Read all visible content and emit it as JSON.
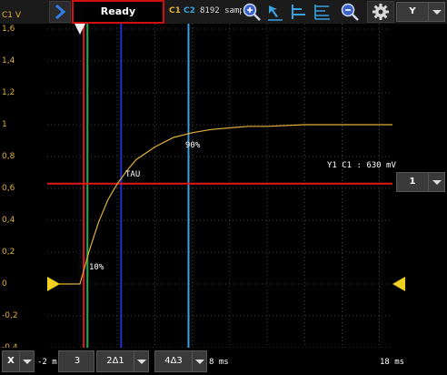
{
  "toolbar": {
    "status": "Ready",
    "ch1": "C1",
    "ch2": "C2",
    "samples": "8192 samp",
    "y_selector": "Y",
    "icons": [
      "play-icon",
      "zoom-in-icon",
      "cursor-arrow-icon",
      "align-left-icon",
      "align-lines-icon",
      "zoom-out-icon",
      "gear-icon"
    ]
  },
  "y_axis": {
    "title": "C1 V",
    "ticks": [
      "1,6",
      "1,4",
      "1,2",
      "1",
      "0,8",
      "0,6",
      "0,4",
      "0,2",
      "0",
      "-0,2",
      "-0,4"
    ]
  },
  "plot_labels": {
    "p10": "10%",
    "p90": "90%",
    "tau": "TAU"
  },
  "readout": "Y1 C1 : 630 mV",
  "right_panel": {
    "channel_select": "1"
  },
  "bottom_bar": {
    "axis_select": "X",
    "left_time": "-2 m",
    "cursor_select": "3",
    "delta_1": "2Δ1",
    "delta_2": "4Δ3",
    "delta_time": "8 ms",
    "right_time": "18 ms"
  },
  "colors": {
    "trace": "#e0b03a",
    "cursor_red": "#e01818",
    "cursor_green": "#22b04a",
    "cursor_blue": "#2030d0",
    "cursor_lightblue": "#3aa0e0",
    "marker_yellow": "#f0d020"
  },
  "chart_data": {
    "type": "line",
    "ylabel": "C1 V",
    "ylim": [
      -0.4,
      1.6
    ],
    "yticks": [
      1.6,
      1.4,
      1.2,
      1.0,
      0.8,
      0.6,
      0.4,
      0.2,
      0,
      -0.2,
      -0.4
    ],
    "xlim": [
      -2,
      18
    ],
    "x_unit": "ms",
    "grid": true,
    "series": [
      {
        "x": [
          -2,
          -1,
          0,
          0.5,
          1,
          1.5,
          2,
          2.5,
          3,
          4,
          5,
          6,
          7,
          8,
          9,
          10,
          12,
          14,
          16,
          18
        ],
        "values": [
          0,
          0,
          0,
          0.21,
          0.39,
          0.53,
          0.63,
          0.71,
          0.78,
          0.86,
          0.92,
          0.95,
          0.97,
          0.98,
          0.99,
          0.99,
          1.0,
          1.0,
          1.0,
          1.0
        ]
      }
    ],
    "cursors": {
      "vertical": [
        {
          "name": "red",
          "x": 0.2
        },
        {
          "name": "green",
          "x": 0.4
        },
        {
          "name": "blue",
          "x": 2.2
        },
        {
          "name": "lightblue",
          "x": 5.8
        }
      ],
      "horizontal": [
        {
          "name": "red",
          "y": 0.63
        }
      ]
    },
    "annotations": [
      "10%",
      "TAU",
      "90%"
    ]
  }
}
